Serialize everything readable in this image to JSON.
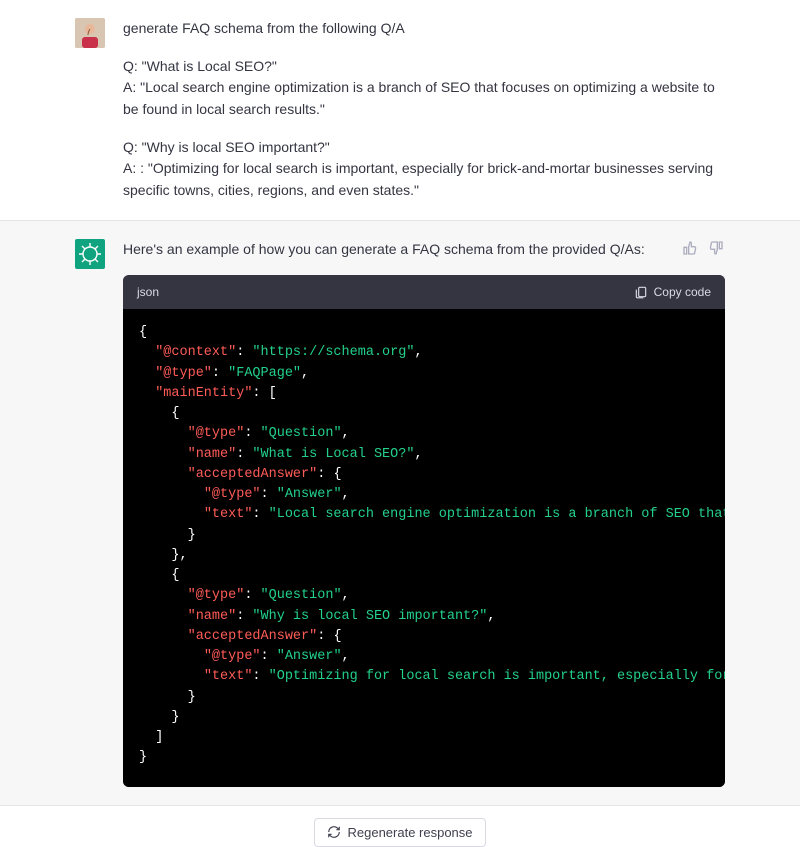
{
  "user": {
    "lines": [
      "generate FAQ schema from the following Q/A",
      "",
      "Q: \"What is Local SEO?\"",
      "A: \"Local search engine optimization is a branch of SEO that focuses on optimizing a website to be found in local search results.\"",
      "",
      "Q: \"Why is local SEO important?\"",
      "A: : \"Optimizing for local search is important, especially for brick-and-mortar businesses serving specific towns, cities, regions, and even states.\""
    ]
  },
  "assistant": {
    "intro": "Here's an example of how you can generate a FAQ schema from the provided Q/As:",
    "code_lang": "json",
    "copy_label": "Copy code",
    "regenerate_label": "Regenerate response",
    "json_schema": {
      "@context": "https://schema.org",
      "@type": "FAQPage",
      "mainEntity": [
        {
          "@type": "Question",
          "name": "What is Local SEO?",
          "acceptedAnswer": {
            "@type": "Answer",
            "text": "Local search engine optimization is a branch of SEO that focuses on optimizing a website to be found in local search results."
          }
        },
        {
          "@type": "Question",
          "name": "Why is local SEO important?",
          "acceptedAnswer": {
            "@type": "Answer",
            "text": "Optimizing for local search is important, especially for brick-and-mortar businesses serving specific towns, cities, regions, and even states."
          }
        }
      ]
    }
  }
}
